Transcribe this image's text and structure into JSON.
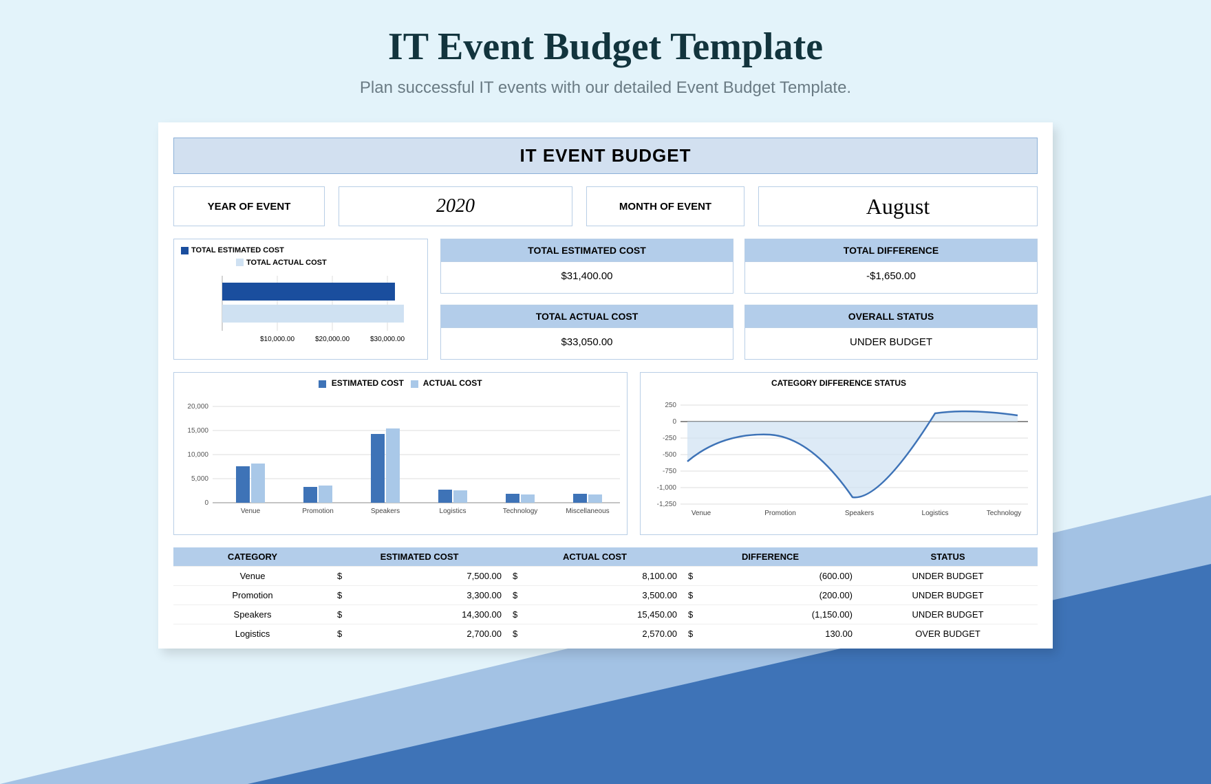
{
  "hero": {
    "title": "IT Event Budget Template",
    "subtitle": "Plan successful IT events with our detailed Event Budget Template."
  },
  "banner": "IT EVENT BUDGET",
  "meta": {
    "year_label": "YEAR OF EVENT",
    "year_value": "2020",
    "month_label": "MONTH OF EVENT",
    "month_value": "August"
  },
  "mini_legend": {
    "a": "TOTAL ESTIMATED COST",
    "b": "TOTAL ACTUAL COST"
  },
  "kpi": {
    "est_label": "TOTAL ESTIMATED COST",
    "est_value": "$31,400.00",
    "diff_label": "TOTAL DIFFERENCE",
    "diff_value": "-$1,650.00",
    "act_label": "TOTAL ACTUAL COST",
    "act_value": "$33,050.00",
    "status_label": "OVERALL STATUS",
    "status_value": "UNDER BUDGET"
  },
  "bar_legend": {
    "a": "ESTIMATED COST",
    "b": "ACTUAL COST"
  },
  "diff_title": "CATEGORY DIFFERENCE STATUS",
  "cols": {
    "cat": "CATEGORY",
    "est": "ESTIMATED COST",
    "act": "ACTUAL COST",
    "diff": "DIFFERENCE",
    "status": "STATUS"
  },
  "rows": [
    {
      "cat": "Venue",
      "est": "7,500.00",
      "act": "8,100.00",
      "diff": "(600.00)",
      "status": "UNDER BUDGET"
    },
    {
      "cat": "Promotion",
      "est": "3,300.00",
      "act": "3,500.00",
      "diff": "(200.00)",
      "status": "UNDER BUDGET"
    },
    {
      "cat": "Speakers",
      "est": "14,300.00",
      "act": "15,450.00",
      "diff": "(1,150.00)",
      "status": "UNDER BUDGET"
    },
    {
      "cat": "Logistics",
      "est": "2,700.00",
      "act": "2,570.00",
      "diff": "130.00",
      "status": "OVER BUDGET"
    }
  ],
  "chart_data": [
    {
      "type": "bar",
      "orientation": "horizontal",
      "title": "Total Cost",
      "categories": [
        "TOTAL ESTIMATED COST",
        "TOTAL ACTUAL COST"
      ],
      "values": [
        31400,
        33050
      ],
      "xlim": [
        0,
        35000
      ],
      "xticks": [
        "$10,000.00",
        "$20,000.00",
        "$30,000.00"
      ]
    },
    {
      "type": "bar",
      "title": "Estimated vs Actual",
      "categories": [
        "Venue",
        "Promotion",
        "Speakers",
        "Logistics",
        "Technology",
        "Miscellaneous"
      ],
      "series": [
        {
          "name": "ESTIMATED COST",
          "values": [
            7500,
            3300,
            14300,
            2700,
            1800,
            1800
          ]
        },
        {
          "name": "ACTUAL COST",
          "values": [
            8100,
            3500,
            15450,
            2570,
            1700,
            1730
          ]
        }
      ],
      "ylim": [
        0,
        20000
      ],
      "yticks": [
        0,
        5000,
        10000,
        15000,
        20000
      ]
    },
    {
      "type": "area",
      "title": "CATEGORY DIFFERENCE STATUS",
      "categories": [
        "Venue",
        "Promotion",
        "Speakers",
        "Logistics",
        "Technology"
      ],
      "values": [
        -600,
        -200,
        -1150,
        130,
        100
      ],
      "ylim": [
        -1250,
        250
      ],
      "yticks": [
        -1250,
        -1000,
        -750,
        -500,
        -250,
        0,
        250
      ]
    }
  ]
}
